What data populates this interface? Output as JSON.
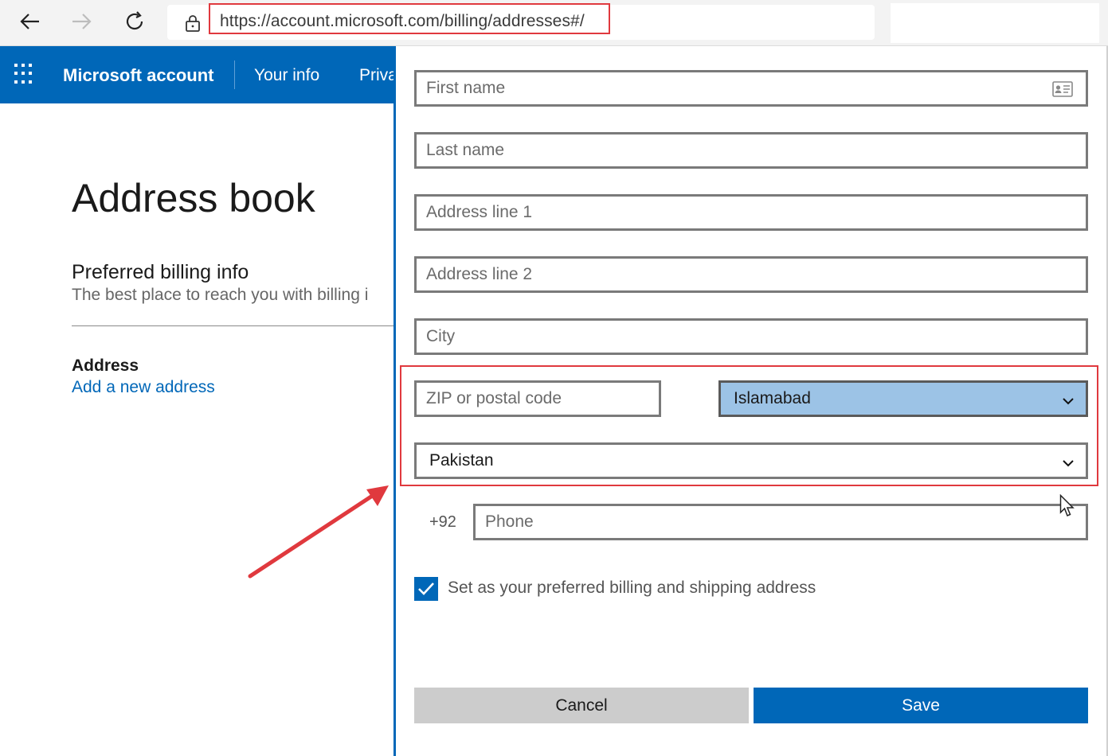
{
  "browser": {
    "url": "https://account.microsoft.com/billing/addresses#/",
    "back_icon": "back-arrow-icon",
    "forward_icon": "forward-arrow-icon",
    "reload_icon": "reload-icon",
    "lock_icon": "lock-icon",
    "favorite_icon": "add-favorite-icon"
  },
  "header": {
    "brand": "Microsoft account",
    "nav": [
      "Your info",
      "Priva"
    ],
    "accent": "#0067b8"
  },
  "page": {
    "title": "Address book",
    "preferred_title": "Preferred billing info",
    "preferred_subtitle": "The best place to reach you with billing i",
    "address_heading": "Address",
    "add_link": "Add a new address"
  },
  "form": {
    "first_name_placeholder": "First name",
    "last_name_placeholder": "Last name",
    "address1_placeholder": "Address line 1",
    "address2_placeholder": "Address line 2",
    "city_placeholder": "City",
    "zip_placeholder": "ZIP or postal code",
    "region_value": "Islamabad",
    "country_value": "Pakistan",
    "phone_prefix": "+92",
    "phone_placeholder": "Phone",
    "preferred_checkbox_label": "Set as your preferred billing and shipping address",
    "preferred_checked": true,
    "cancel_label": "Cancel",
    "save_label": "Save"
  },
  "annotation_color": "#e0393e"
}
